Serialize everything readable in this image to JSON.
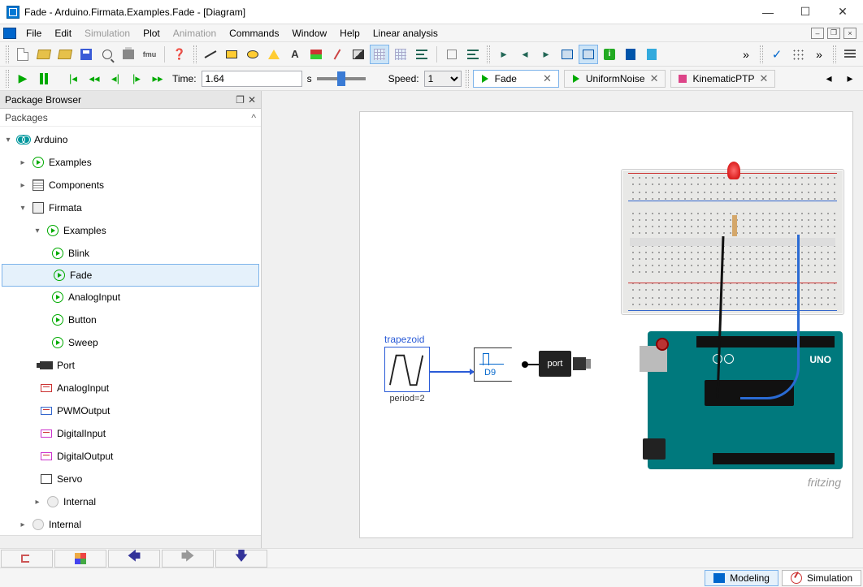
{
  "window": {
    "title": "Fade - Arduino.Firmata.Examples.Fade  - [Diagram]"
  },
  "menu": {
    "items": [
      "File",
      "Edit",
      "Simulation",
      "Plot",
      "Animation",
      "Commands",
      "Window",
      "Help",
      "Linear analysis"
    ],
    "disabled": [
      2,
      4
    ]
  },
  "sim": {
    "time_label": "Time:",
    "time_value": "1.64",
    "time_unit": "s",
    "speed_label": "Speed:",
    "speed_value": "1"
  },
  "tabs": [
    {
      "label": "Fade",
      "active": true,
      "icon": "play"
    },
    {
      "label": "UniformNoise",
      "active": false,
      "icon": "play"
    },
    {
      "label": "KinematicPTP",
      "active": false,
      "icon": "block"
    }
  ],
  "package_browser": {
    "title": "Package Browser",
    "subtitle": "Packages",
    "tree": {
      "root": "Arduino",
      "examples": "Examples",
      "components": "Components",
      "firmata": "Firmata",
      "firmata_examples": "Examples",
      "items": [
        "Blink",
        "Fade",
        "AnalogInput",
        "Button",
        "Sweep"
      ],
      "selected": "Fade",
      "port": "Port",
      "analog_input": "AnalogInput",
      "pwm_output": "PWMOutput",
      "digital_input": "DigitalInput",
      "digital_output": "DigitalOutput",
      "servo": "Servo",
      "internal1": "Internal",
      "internal2": "Internal"
    }
  },
  "diagram": {
    "trapezoid": {
      "label": "trapezoid",
      "sub": "period=2"
    },
    "pwm_block": {
      "label": "D9"
    },
    "port_block": {
      "label": "port"
    },
    "board": {
      "name": "UNO"
    },
    "credit": "fritzing"
  },
  "status": {
    "modeling": "Modeling",
    "simulation": "Simulation"
  }
}
